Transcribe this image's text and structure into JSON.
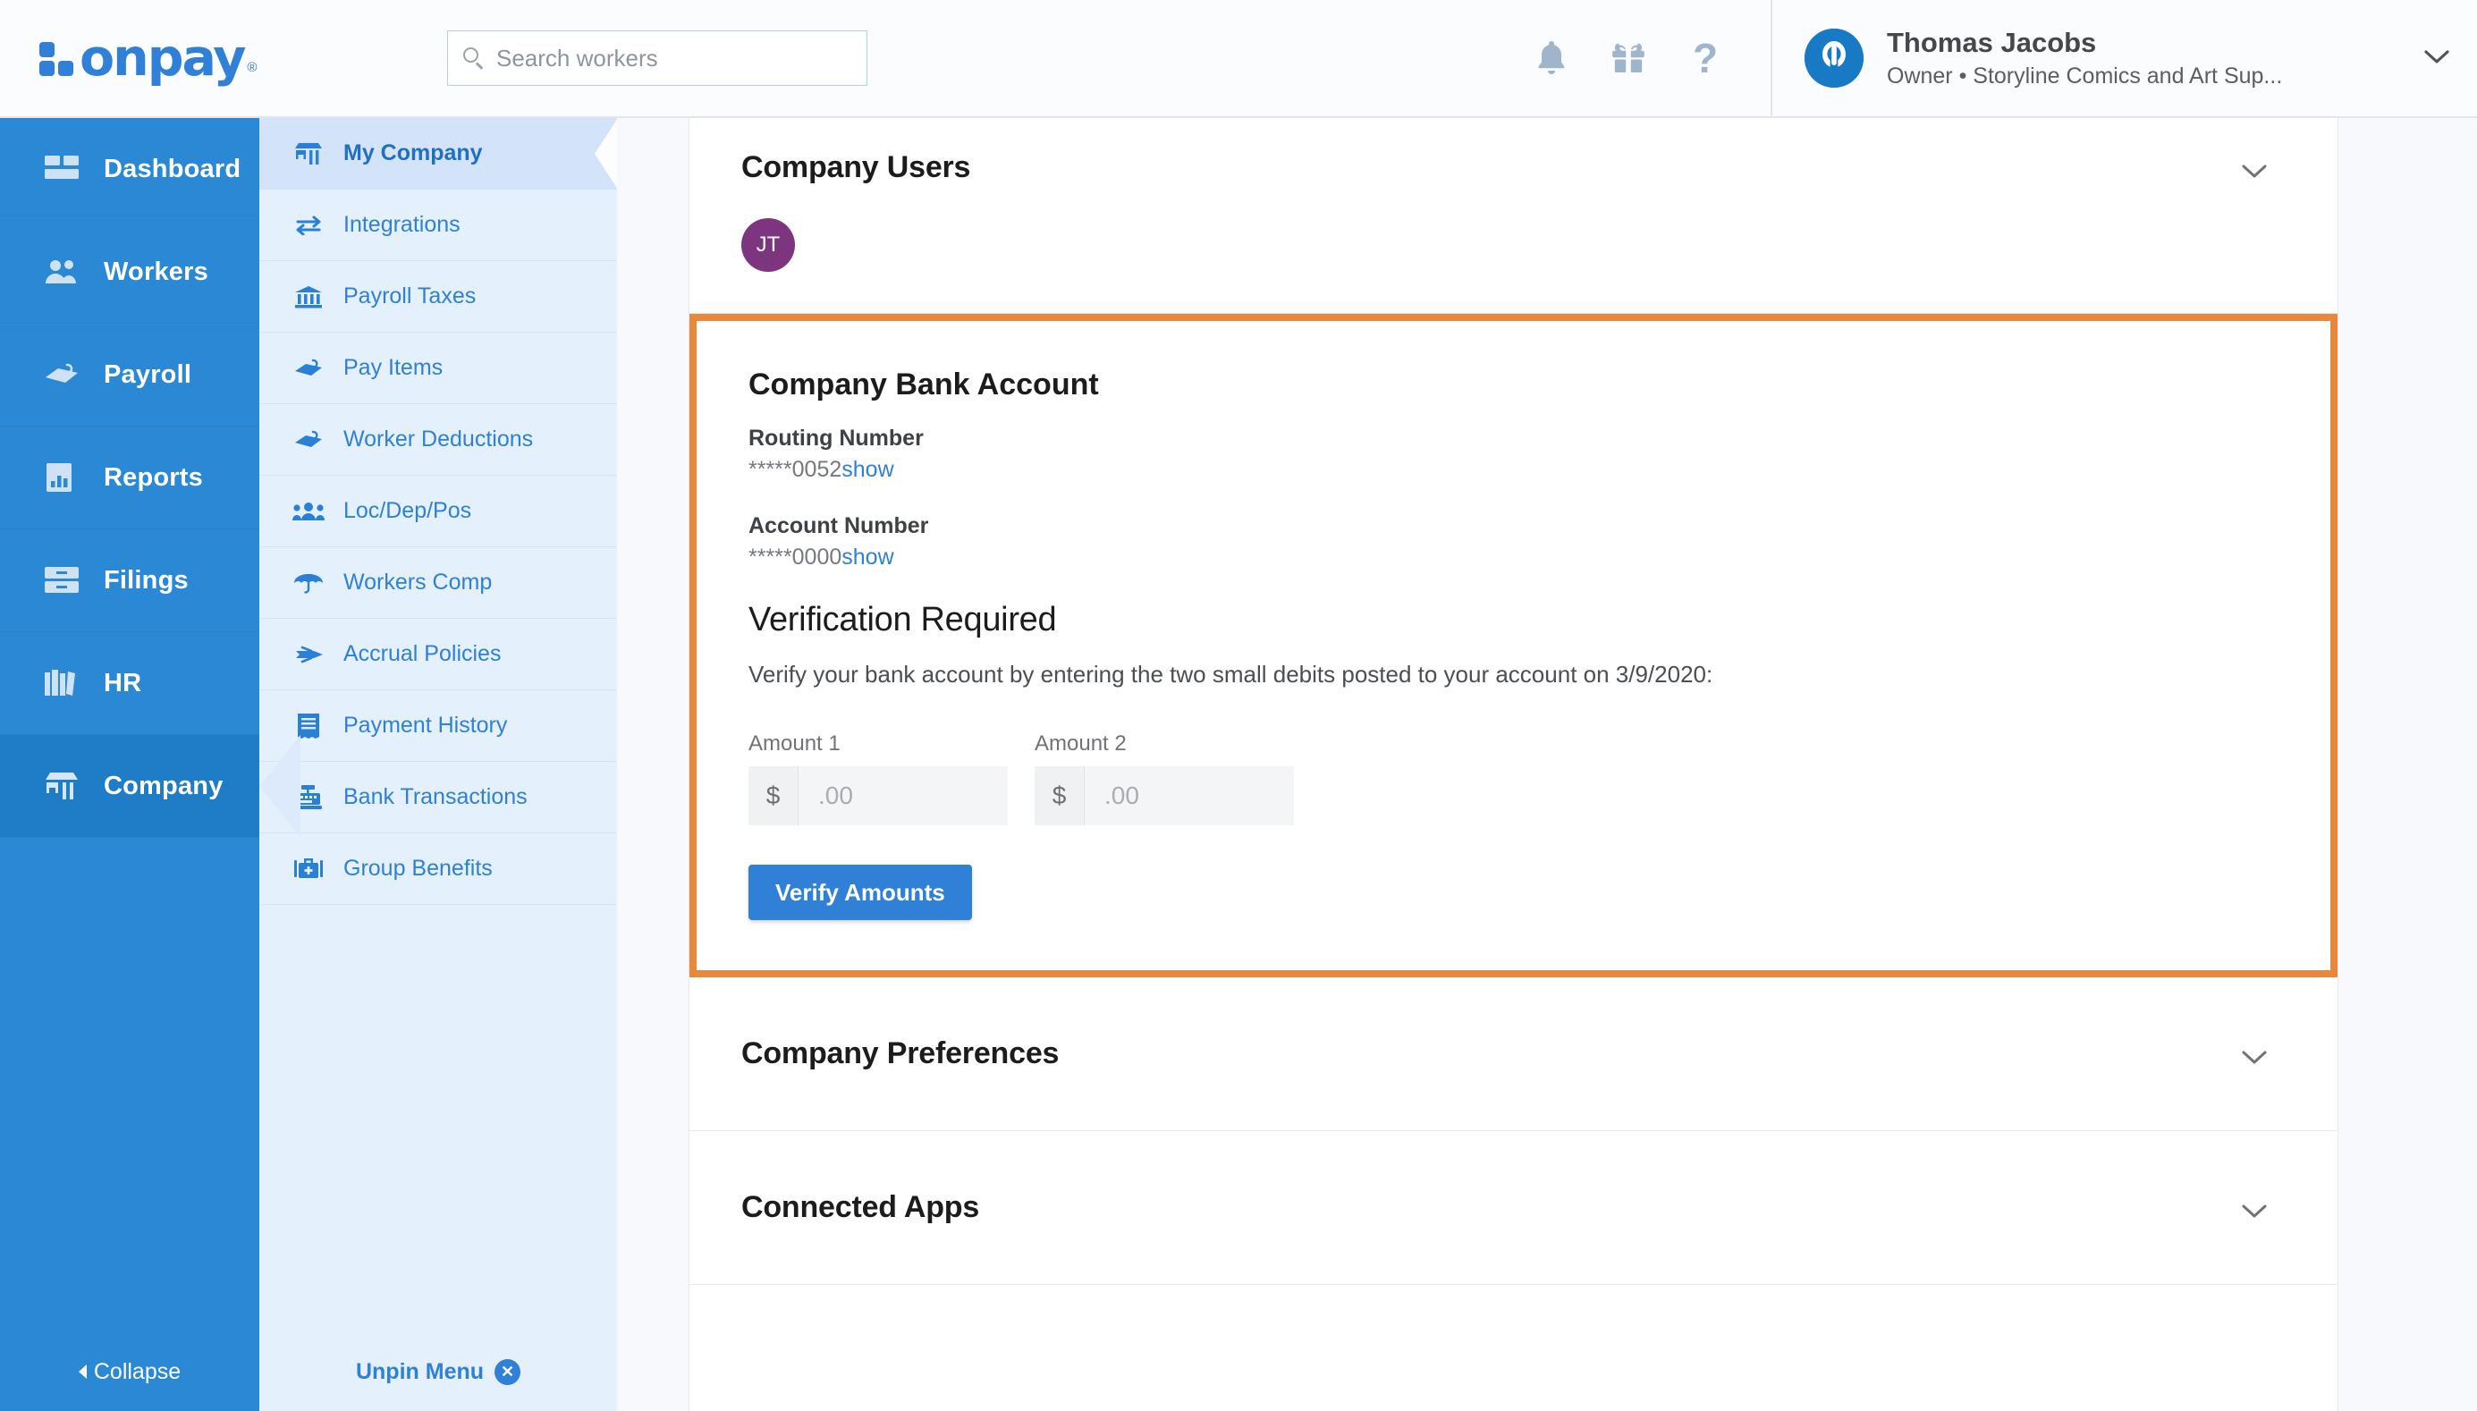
{
  "brand": {
    "name": "onpay",
    "registered": "®",
    "accent": "#2f80d6",
    "highlight": "#e8883a"
  },
  "topbar": {
    "search": {
      "placeholder": "Search workers",
      "value": "",
      "icon": "search-icon"
    },
    "icons": [
      {
        "name": "notifications-bell-icon",
        "label": "Notifications"
      },
      {
        "name": "gift-icon",
        "label": "Refer"
      },
      {
        "name": "help-question-icon",
        "label": "?"
      }
    ],
    "user": {
      "initials_avatar": "power-logo-avatar",
      "name": "Thomas Jacobs",
      "role": "Owner • Storyline Comics and Art Sup...",
      "caret": "⌄"
    }
  },
  "nav": {
    "items": [
      {
        "label": "Dashboard",
        "icon": "dashboard-grid-icon",
        "active": false
      },
      {
        "label": "Workers",
        "icon": "workers-people-icon",
        "active": false
      },
      {
        "label": "Payroll",
        "icon": "payroll-hand-icon",
        "active": false
      },
      {
        "label": "Reports",
        "icon": "reports-chart-icon",
        "active": false
      },
      {
        "label": "Filings",
        "icon": "filings-drawer-icon",
        "active": false
      },
      {
        "label": "HR",
        "icon": "hr-books-icon",
        "active": false
      },
      {
        "label": "Company",
        "icon": "company-store-icon",
        "active": true
      }
    ],
    "collapse_label": "Collapse"
  },
  "subnav": {
    "items": [
      {
        "label": "My Company",
        "icon": "store-icon",
        "active": true
      },
      {
        "label": "Integrations",
        "icon": "integrations-arrows-icon",
        "active": false
      },
      {
        "label": "Payroll Taxes",
        "icon": "bank-building-icon",
        "active": false
      },
      {
        "label": "Pay Items",
        "icon": "pay-hand-icon",
        "active": false
      },
      {
        "label": "Worker Deductions",
        "icon": "deduction-hand-icon",
        "active": false
      },
      {
        "label": "Loc/Dep/Pos",
        "icon": "group-people-icon",
        "active": false
      },
      {
        "label": "Workers Comp",
        "icon": "umbrella-icon",
        "active": false
      },
      {
        "label": "Accrual Policies",
        "icon": "airplane-icon",
        "active": false
      },
      {
        "label": "Payment History",
        "icon": "receipt-icon",
        "active": false
      },
      {
        "label": "Bank Transactions",
        "icon": "register-icon",
        "active": false
      },
      {
        "label": "Group Benefits",
        "icon": "medical-kit-icon",
        "active": false
      }
    ],
    "unpin_label": "Unpin Menu",
    "unpin_icon": "close-circle-icon"
  },
  "main": {
    "company_users": {
      "title": "Company Users",
      "avatar_initials": "JT",
      "avatar_color": "#7d3580",
      "chevron": "chevron-down-icon"
    },
    "bank_account": {
      "title": "Company Bank Account",
      "routing": {
        "label": "Routing Number",
        "masked": "*****0052",
        "show_link": "show"
      },
      "account": {
        "label": "Account Number",
        "masked": "*****0000",
        "show_link": "show"
      },
      "verification": {
        "title": "Verification Required",
        "description": "Verify your bank account by entering the two small debits posted to your account on 3/9/2020:",
        "amount1": {
          "label": "Amount 1",
          "currency": "$",
          "placeholder": ".00",
          "value": ""
        },
        "amount2": {
          "label": "Amount 2",
          "currency": "$",
          "placeholder": ".00",
          "value": ""
        },
        "submit_label": "Verify Amounts"
      }
    },
    "preferences": {
      "title": "Company Preferences",
      "chevron": "chevron-down-icon"
    },
    "connected_apps": {
      "title": "Connected Apps",
      "chevron": "chevron-down-icon"
    }
  }
}
